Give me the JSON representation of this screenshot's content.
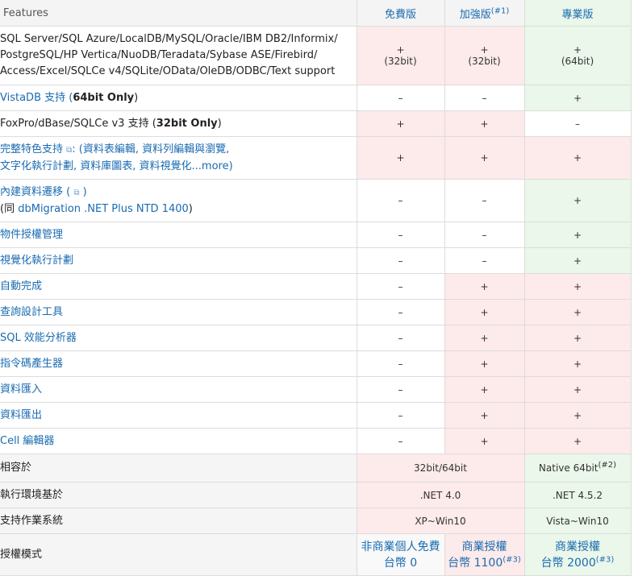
{
  "header": {
    "features": "Features",
    "editions": [
      "免費版",
      "加強版",
      "專業版"
    ],
    "edition2_note": "(#1)"
  },
  "rows": [
    {
      "feature_lines": [
        "SQL Server/SQL Azure/LocalDB/MySQL/Oracle/IBM DB2/Informix/",
        "PostgreSQL/HP Vertica/NuoDB/Teradata/Sybase ASE/Firebird/",
        "Access/Excel/SQLCe v4/SQLite/OData/OleDB/ODBC/Text support"
      ],
      "cells": [
        {
          "mark": "+",
          "note": "(32bit)"
        },
        {
          "mark": "+",
          "note": "(32bit)"
        },
        {
          "mark": "+",
          "note": "(64bit)"
        }
      ]
    },
    {
      "feature_pre": "VistaDB 支持 (",
      "feature_bold": "64bit Only",
      "feature_post": ")",
      "cells": [
        "–",
        "–",
        "+"
      ]
    },
    {
      "feature_pre": "FoxPro/dBase/SQLCe v3 支持 (",
      "feature_bold": "32bit Only",
      "feature_post": ")",
      "cells": [
        "+",
        "+",
        "–"
      ]
    },
    {
      "feature_line1_link": "完整特色支持",
      "feature_line1_rest": ": (資料表編輯, 資料列編輯與瀏覽,",
      "feature_line2": "文字化執行計劃, 資料庫圖表, 資料視覺化...more)",
      "cells": [
        "+",
        "+",
        "+"
      ]
    },
    {
      "feature_line1": "內建資料遷移 (",
      "feature_line1_end": ")",
      "feature_line2_pre": "(同 ",
      "feature_line2_link": "dbMigration .NET Plus NTD 1400",
      "feature_line2_post": ")",
      "cells": [
        "–",
        "–",
        "+"
      ]
    },
    {
      "feature": "物件授權管理",
      "cells": [
        "–",
        "–",
        "+"
      ]
    },
    {
      "feature": "視覺化執行計劃",
      "cells": [
        "–",
        "–",
        "+"
      ]
    },
    {
      "feature": "自動完成",
      "cells": [
        "–",
        "+",
        "+"
      ]
    },
    {
      "feature": "查詢設計工具",
      "cells": [
        "–",
        "+",
        "+"
      ]
    },
    {
      "feature": "SQL 效能分析器",
      "cells": [
        "–",
        "+",
        "+"
      ]
    },
    {
      "feature": "指令碼產生器",
      "cells": [
        "–",
        "+",
        "+"
      ]
    },
    {
      "feature": "資料匯入",
      "cells": [
        "–",
        "+",
        "+"
      ]
    },
    {
      "feature": "資料匯出",
      "cells": [
        "–",
        "+",
        "+"
      ]
    },
    {
      "feature": "Cell 編輯器",
      "cells": [
        "–",
        "+",
        "+"
      ]
    }
  ],
  "specs": [
    {
      "label": "相容於",
      "free_plus": "32bit/64bit",
      "pro": "Native 64bit",
      "pro_note": "(#2)"
    },
    {
      "label": "執行環境基於",
      "free_plus": ".NET 4.0",
      "pro": ".NET 4.5.2"
    },
    {
      "label": "支持作業系統",
      "free_plus": "XP~Win10",
      "pro": "Vista~Win10"
    }
  ],
  "license": {
    "label": "授權模式",
    "free": [
      "非商業個人免費",
      "台幣 0"
    ],
    "plus": [
      "商業授權",
      "台幣 1100"
    ],
    "plus_note": "(#3)",
    "pro": [
      "商業授權",
      "台幣 2000"
    ],
    "pro_note": "(#3)"
  },
  "colors": {
    "link": "#1a6bb0",
    "pink": "#fdeaea",
    "green": "#eaf7ea",
    "header": "#f4f4f4"
  }
}
